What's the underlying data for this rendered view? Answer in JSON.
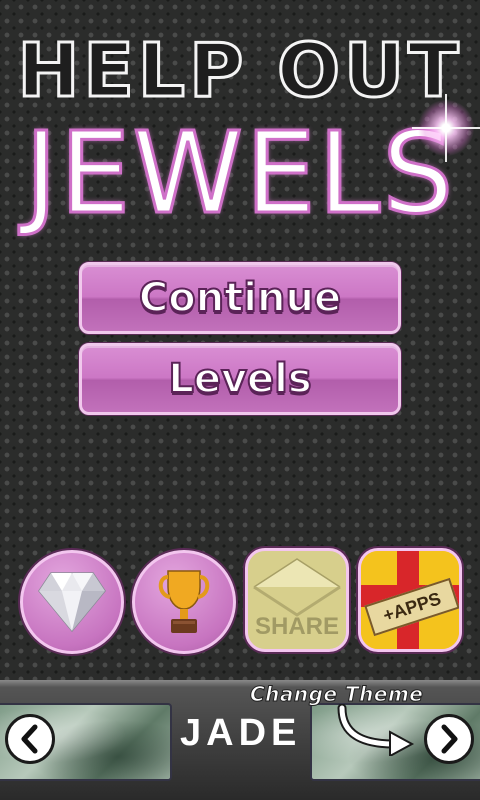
{
  "title": {
    "line1": "HELP OUT",
    "line2": "JEWELS"
  },
  "menu": {
    "continue_label": "Continue",
    "levels_label": "Levels"
  },
  "icon_buttons": {
    "diamond": "diamond-icon",
    "trophy": "trophy-icon",
    "share_label": "SHARE",
    "apps_label": "+APPS"
  },
  "theme": {
    "change_label": "Change Theme",
    "current": "JADE"
  },
  "colors": {
    "button": "#cc77c5",
    "title_glow": "#cf70c8",
    "accent_outline": "#5b2358"
  }
}
